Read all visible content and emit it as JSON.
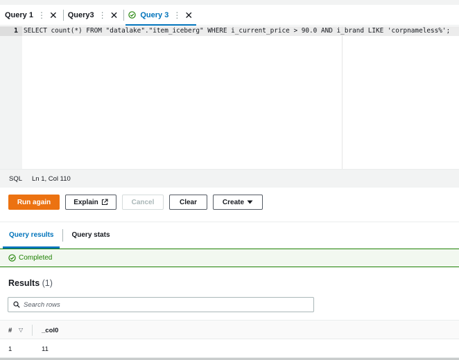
{
  "tabs": [
    {
      "label": "Query 1",
      "active": false,
      "icon": "none"
    },
    {
      "label": "Query3",
      "active": false,
      "icon": "none"
    },
    {
      "label": "Query 3",
      "active": true,
      "icon": "check-circle-icon"
    }
  ],
  "tab_controls": {
    "menu_glyph": "⋮",
    "close_glyph": "✕"
  },
  "editor": {
    "line_number": "1",
    "code": "SELECT count(*) FROM \"datalake\".\"item_iceberg\" WHERE i_current_price > 90.0 AND i_brand LIKE 'corpnameless%';"
  },
  "status_bar": {
    "language": "SQL",
    "cursor": "Ln 1, Col 110"
  },
  "actions": {
    "run_label": "Run again",
    "explain_label": "Explain",
    "cancel_label": "Cancel",
    "clear_label": "Clear",
    "create_label": "Create"
  },
  "result_tabs": [
    {
      "label": "Query results",
      "active": true
    },
    {
      "label": "Query stats",
      "active": false
    }
  ],
  "status": {
    "text": "Completed",
    "color": "#1d8102"
  },
  "results": {
    "title": "Results",
    "count": "(1)"
  },
  "search": {
    "placeholder": "Search rows"
  },
  "table": {
    "columns": [
      "#",
      "_col0"
    ],
    "rows": [
      [
        "1",
        "11"
      ]
    ]
  },
  "colors": {
    "accent": "#0073bb",
    "primary_button": "#ec7211",
    "success": "#1d8102"
  }
}
